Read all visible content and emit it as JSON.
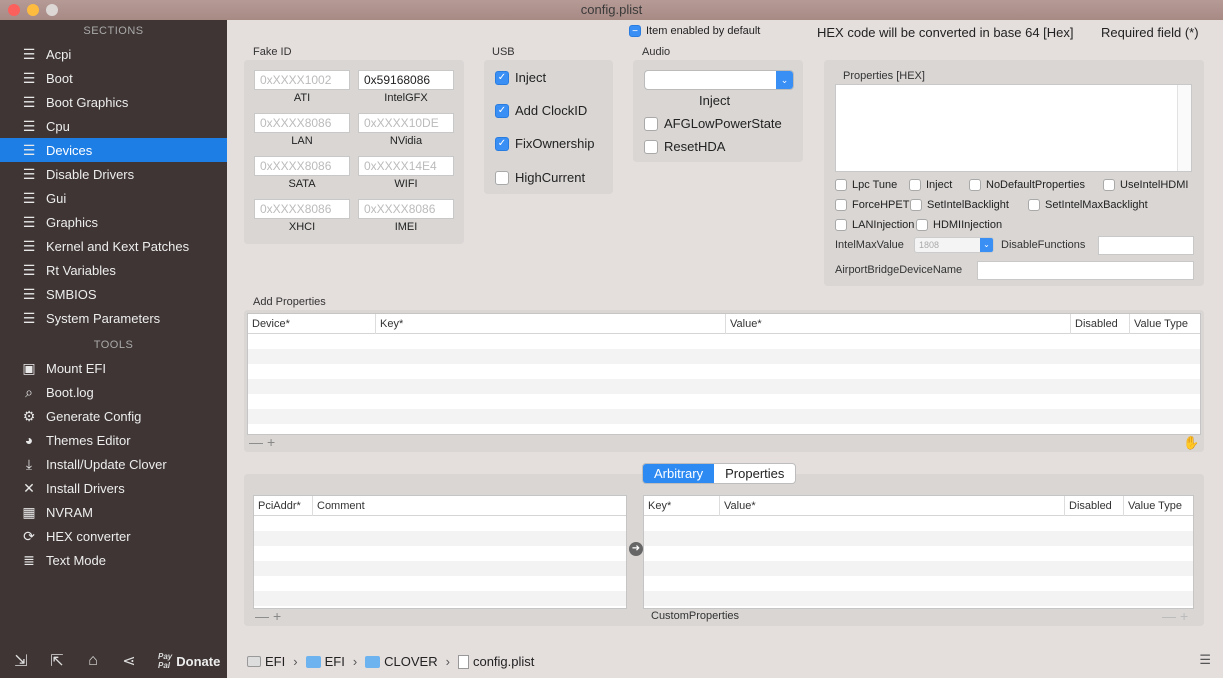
{
  "window": {
    "title": "config.plist"
  },
  "sidebar": {
    "sections_header": "SECTIONS",
    "sections": [
      {
        "label": "Acpi",
        "icon": "list-icon"
      },
      {
        "label": "Boot",
        "icon": "list-icon"
      },
      {
        "label": "Boot Graphics",
        "icon": "list-icon"
      },
      {
        "label": "Cpu",
        "icon": "list-icon"
      },
      {
        "label": "Devices",
        "icon": "list-icon",
        "active": true
      },
      {
        "label": "Disable Drivers",
        "icon": "list-icon"
      },
      {
        "label": "Gui",
        "icon": "list-icon"
      },
      {
        "label": "Graphics",
        "icon": "list-icon"
      },
      {
        "label": "Kernel and Kext Patches",
        "icon": "list-icon"
      },
      {
        "label": "Rt Variables",
        "icon": "list-icon"
      },
      {
        "label": "SMBIOS",
        "icon": "list-icon"
      },
      {
        "label": "System Parameters",
        "icon": "list-icon"
      }
    ],
    "tools_header": "TOOLS",
    "tools": [
      {
        "label": "Mount EFI",
        "icon": "disk-icon"
      },
      {
        "label": "Boot.log",
        "icon": "log-search-icon"
      },
      {
        "label": "Generate Config",
        "icon": "gears-icon"
      },
      {
        "label": "Themes Editor",
        "icon": "palette-icon"
      },
      {
        "label": "Install/Update Clover",
        "icon": "download-icon"
      },
      {
        "label": "Install Drivers",
        "icon": "tools-icon"
      },
      {
        "label": "NVRAM",
        "icon": "chip-icon"
      },
      {
        "label": "HEX converter",
        "icon": "refresh-icon"
      },
      {
        "label": "Text Mode",
        "icon": "text-icon"
      }
    ],
    "bottom": {
      "donate_label": "Donate",
      "paypal_line1": "Pay",
      "paypal_line2": "Pal"
    }
  },
  "header": {
    "item_enabled_label": "Item enabled by default",
    "hex_note": "HEX code will be converted in base 64 [Hex]",
    "required_note": "Required field (*)"
  },
  "fake_id": {
    "title": "Fake ID",
    "fields": [
      {
        "placeholder": "0xXXXX1002",
        "value": "",
        "caption": "ATI"
      },
      {
        "placeholder": "",
        "value": "0x59168086",
        "caption": "IntelGFX"
      },
      {
        "placeholder": "0xXXXX8086",
        "value": "",
        "caption": "LAN"
      },
      {
        "placeholder": "0xXXXX10DE",
        "value": "",
        "caption": "NVidia"
      },
      {
        "placeholder": "0xXXXX8086",
        "value": "",
        "caption": "SATA"
      },
      {
        "placeholder": "0xXXXX14E4",
        "value": "",
        "caption": "WIFI"
      },
      {
        "placeholder": "0xXXXX8086",
        "value": "",
        "caption": "XHCI"
      },
      {
        "placeholder": "0xXXXX8086",
        "value": "",
        "caption": "IMEI"
      }
    ]
  },
  "usb": {
    "title": "USB",
    "options": [
      {
        "label": "Inject",
        "checked": true
      },
      {
        "label": "Add ClockID",
        "checked": true
      },
      {
        "label": "FixOwnership",
        "checked": true
      },
      {
        "label": "HighCurrent",
        "checked": false
      }
    ]
  },
  "audio": {
    "title": "Audio",
    "select_value": "",
    "inject_label": "Inject",
    "options": [
      {
        "label": "AFGLowPowerState",
        "checked": false
      },
      {
        "label": "ResetHDA",
        "checked": false
      }
    ]
  },
  "properties_hex": {
    "title": "Properties [HEX]",
    "checks": [
      {
        "label": "Lpc Tune"
      },
      {
        "label": "Inject"
      },
      {
        "label": "NoDefaultProperties"
      },
      {
        "label": "UseIntelHDMI"
      },
      {
        "label": "ForceHPET"
      },
      {
        "label": "SetIntelBacklight"
      },
      {
        "label": "SetIntelMaxBacklight"
      },
      {
        "label": "LANInjection"
      },
      {
        "label": "HDMIInjection"
      }
    ],
    "intel_max_label": "IntelMaxValue",
    "intel_max_value": "1808",
    "disable_functions_label": "DisableFunctions",
    "airport_label": "AirportBridgeDeviceName"
  },
  "add_properties": {
    "title": "Add Properties",
    "columns": [
      "Device*",
      "Key*",
      "Value*",
      "Disabled",
      "Value Type"
    ],
    "add_label": "+",
    "remove_label": "—"
  },
  "arbitrary": {
    "tabs": [
      {
        "label": "Arbitrary",
        "active": true
      },
      {
        "label": "Properties",
        "active": false
      }
    ],
    "left_columns": [
      "PciAddr*",
      "Comment"
    ],
    "right_columns": [
      "Key*",
      "Value*",
      "Disabled",
      "Value Type"
    ],
    "custom_label": "CustomProperties",
    "add_label": "+",
    "remove_label": "—"
  },
  "pathbar": {
    "crumbs": [
      {
        "label": "EFI",
        "icon": "drive-icon"
      },
      {
        "label": "EFI",
        "icon": "folder-icon"
      },
      {
        "label": "CLOVER",
        "icon": "folder-icon"
      },
      {
        "label": "config.plist",
        "icon": "file-icon"
      }
    ],
    "separator": "›"
  },
  "colors": {
    "accent": "#1d7ee6",
    "sidebar_bg": "#3a3434",
    "checkbox_on": "#3a8ff5"
  }
}
